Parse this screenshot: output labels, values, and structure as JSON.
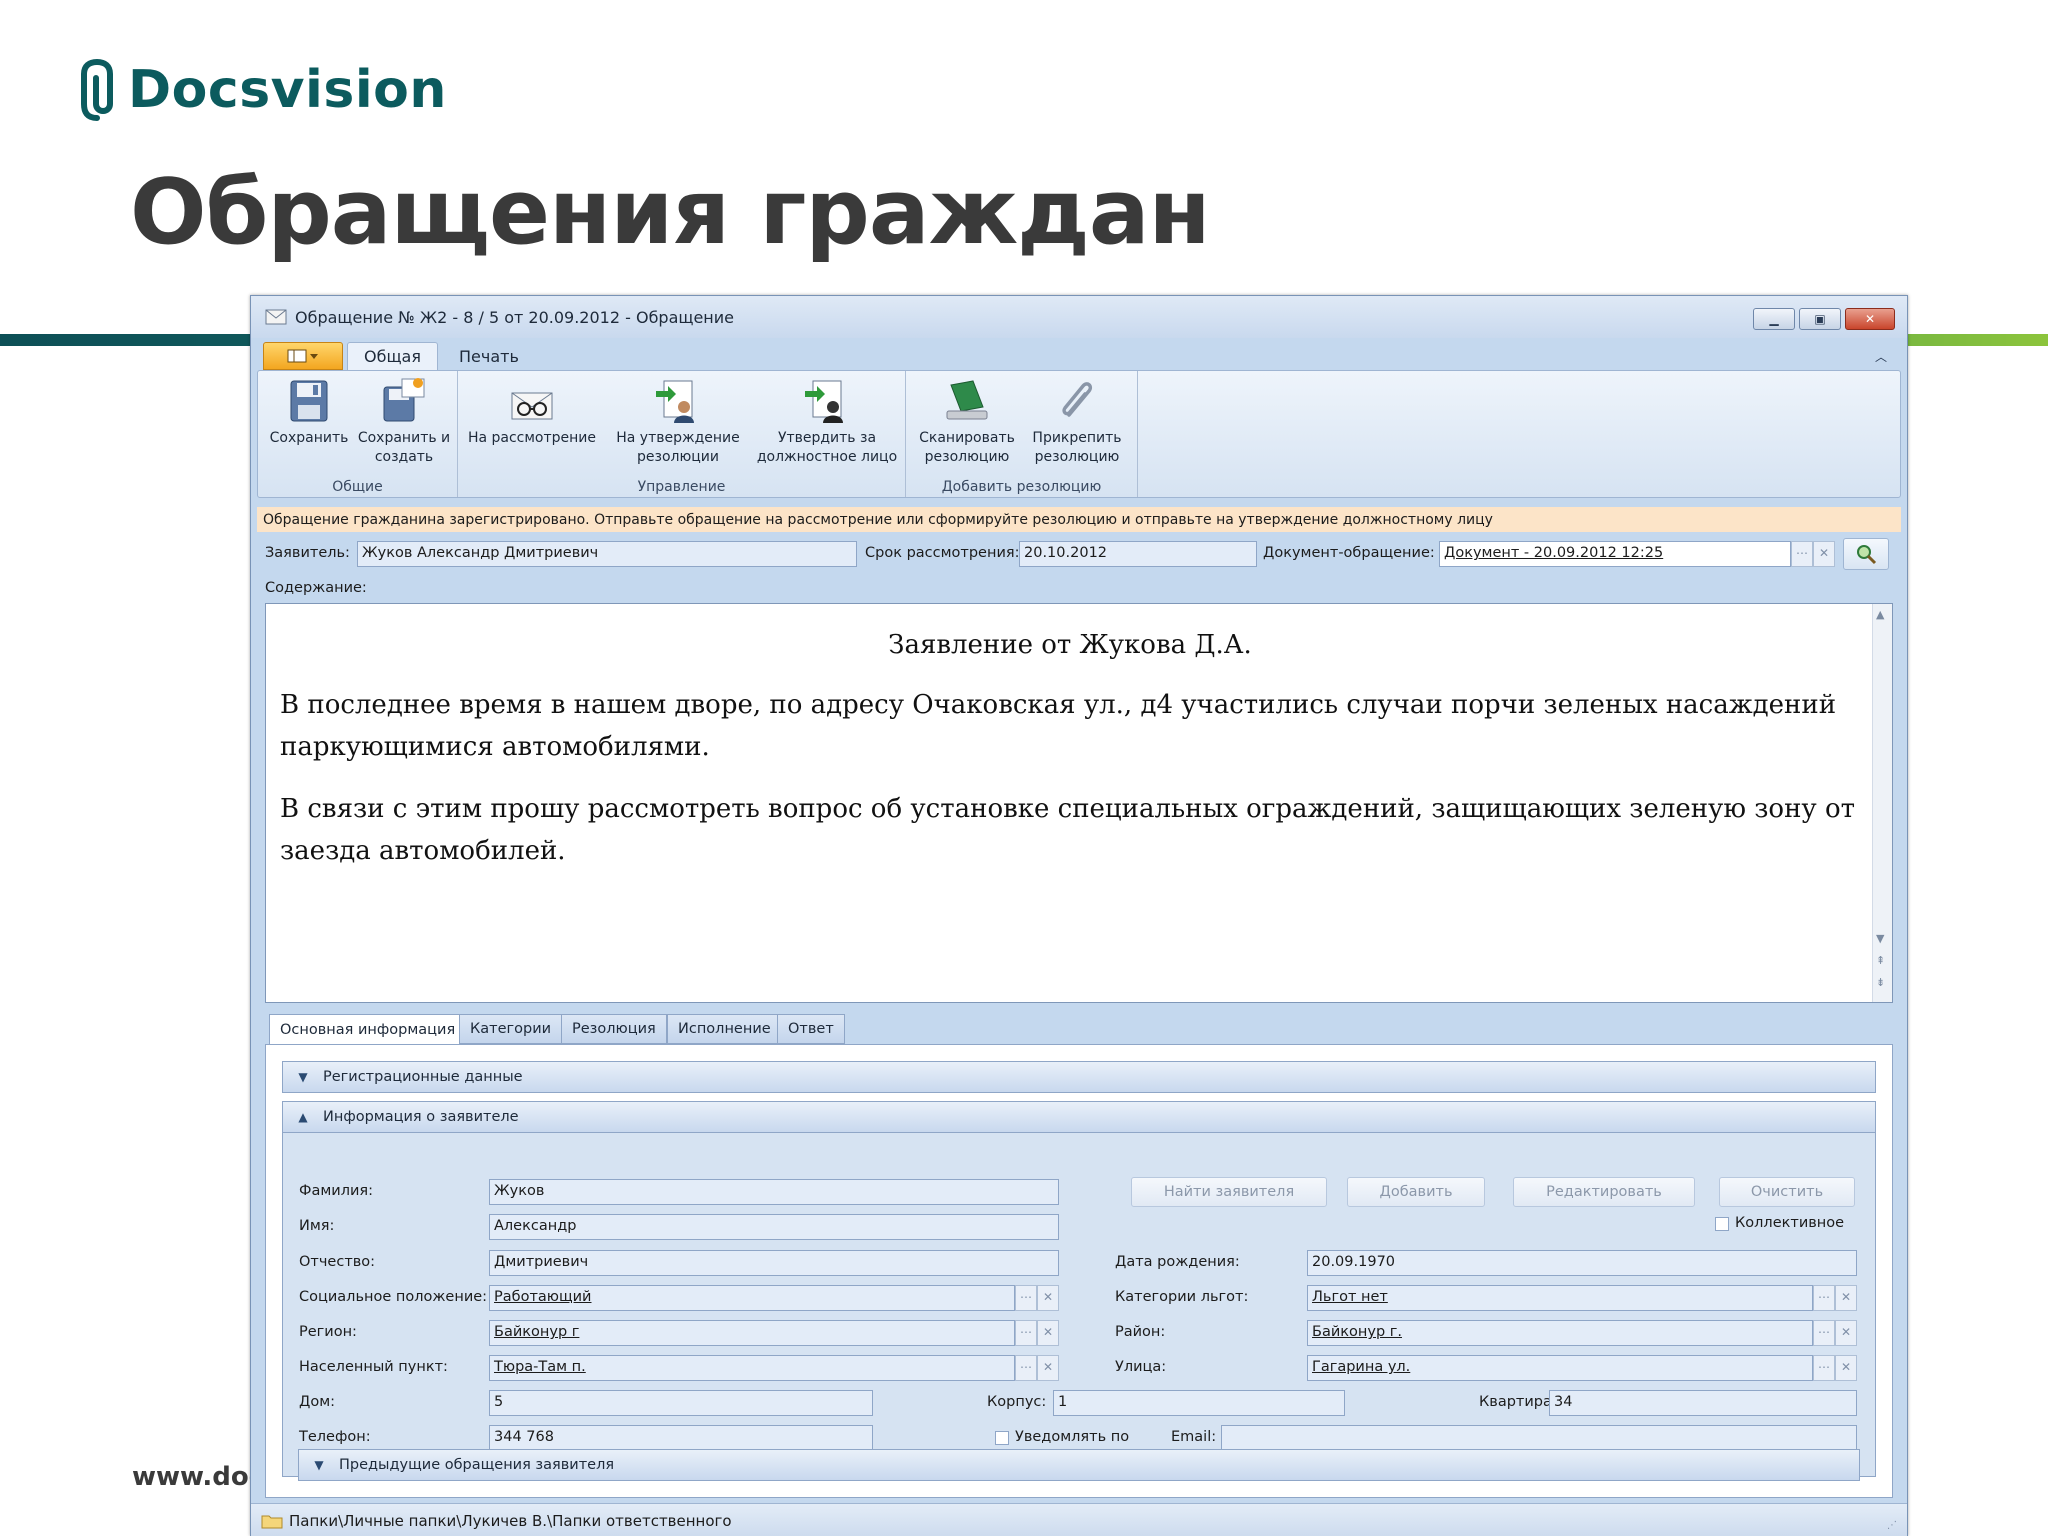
{
  "slide": {
    "logo_text": "Docsvision",
    "title": "Обращения граждан",
    "footer_url": "www.doc"
  },
  "colors": {
    "brand": "#0c5b5e",
    "accent_green": "#8cc43c",
    "info_bar": "#fce4c8",
    "window_bg": "#c4d8ee"
  },
  "window": {
    "title": "Обращение № Ж2 - 8 / 5 от 20.09.2012 - Обращение",
    "controls": {
      "minimize_icon": "minimize-icon",
      "maximize_icon": "maximize-icon",
      "close_icon": "close-icon"
    }
  },
  "ribbon": {
    "tabs": [
      {
        "label": "Общая",
        "active": true
      },
      {
        "label": "Печать",
        "active": false
      }
    ],
    "groups": [
      {
        "label": "Общие",
        "buttons": [
          {
            "label": "Сохранить",
            "icon": "floppy-icon"
          },
          {
            "label": "Сохранить и создать",
            "icon": "save-new-icon"
          }
        ]
      },
      {
        "label": "Управление",
        "buttons": [
          {
            "label": "На рассмотрение",
            "icon": "envelope-glasses-icon"
          },
          {
            "label": "На утверждение резолюции",
            "icon": "approve-resolution-icon"
          },
          {
            "label": "Утвердить за должностное лицо",
            "icon": "approve-official-icon"
          }
        ]
      },
      {
        "label": "Добавить резолюцию",
        "buttons": [
          {
            "label": "Сканировать резолюцию",
            "icon": "scanner-icon"
          },
          {
            "label": "Прикрепить резолюцию",
            "icon": "paperclip-icon"
          }
        ]
      }
    ]
  },
  "info_bar": "Обращение гражданина зарегистрировано.   Отправьте обращение на рассмотрение или сформируйте резолюцию и отправьте на утверждение должностному лицу",
  "header_fields": {
    "applicant_label": "Заявитель:",
    "applicant_value": "Жуков Александр Дмитриевич",
    "deadline_label": "Срок рассмотрения:",
    "deadline_value": "20.10.2012",
    "document_label": "Документ-обращение:",
    "document_value": "Документ - 20.09.2012 12:25"
  },
  "content": {
    "label": "Содержание:",
    "heading": "Заявление от Жукова Д.А.",
    "paragraphs": [
      "В последнее время в нашем дворе, по адресу Очаковская ул., д4 участились случаи порчи зеленых насаждений паркующимися автомобилями.",
      "В связи с этим прошу рассмотреть вопрос об установке специальных ограждений, защищающих зеленую зону от заезда автомобилей."
    ]
  },
  "bottom_tabs": [
    {
      "label": "Основная информация",
      "active": true
    },
    {
      "label": "Категории",
      "active": false
    },
    {
      "label": "Резолюция",
      "active": false
    },
    {
      "label": "Исполнение",
      "active": false
    },
    {
      "label": "Ответ",
      "active": false
    }
  ],
  "sections": {
    "registration": "Регистрационные данные",
    "applicant_info": "Информация о заявителе",
    "previous": "Предыдущие обращения заявителя"
  },
  "applicant": {
    "surname_label": "Фамилия:",
    "surname": "Жуков",
    "name_label": "Имя:",
    "name": "Александр",
    "patronymic_label": "Отчество:",
    "patronymic": "Дмитриевич",
    "social_label": "Социальное положение:",
    "social": "Работающий",
    "region_label": "Регион:",
    "region": "Байконур г",
    "locality_label": "Населенный пункт:",
    "locality": "Тюра-Там п.",
    "house_label": "Дом:",
    "house": "5",
    "phone_label": "Телефон:",
    "phone": "344 768",
    "birthdate_label": "Дата рождения:",
    "birthdate": "20.09.1970",
    "benefits_label": "Категории льгот:",
    "benefits": "Льгот нет",
    "district_label": "Район:",
    "district": "Байконур г.",
    "street_label": "Улица:",
    "street": "Гагарина ул.",
    "building_label": "Корпус:",
    "building": "1",
    "apartment_label": "Квартира:",
    "apartment": "34",
    "notify_label": "Уведомлять по",
    "notify_checked": false,
    "email_label": "Email:",
    "email": "",
    "collective_label": "Коллективное",
    "collective_checked": false
  },
  "action_buttons": {
    "find": "Найти заявителя",
    "add": "Добавить",
    "edit": "Редактировать",
    "clear": "Очистить"
  },
  "status_bar": "Папки\\Личные папки\\Лукичев В.\\Папки ответственного"
}
